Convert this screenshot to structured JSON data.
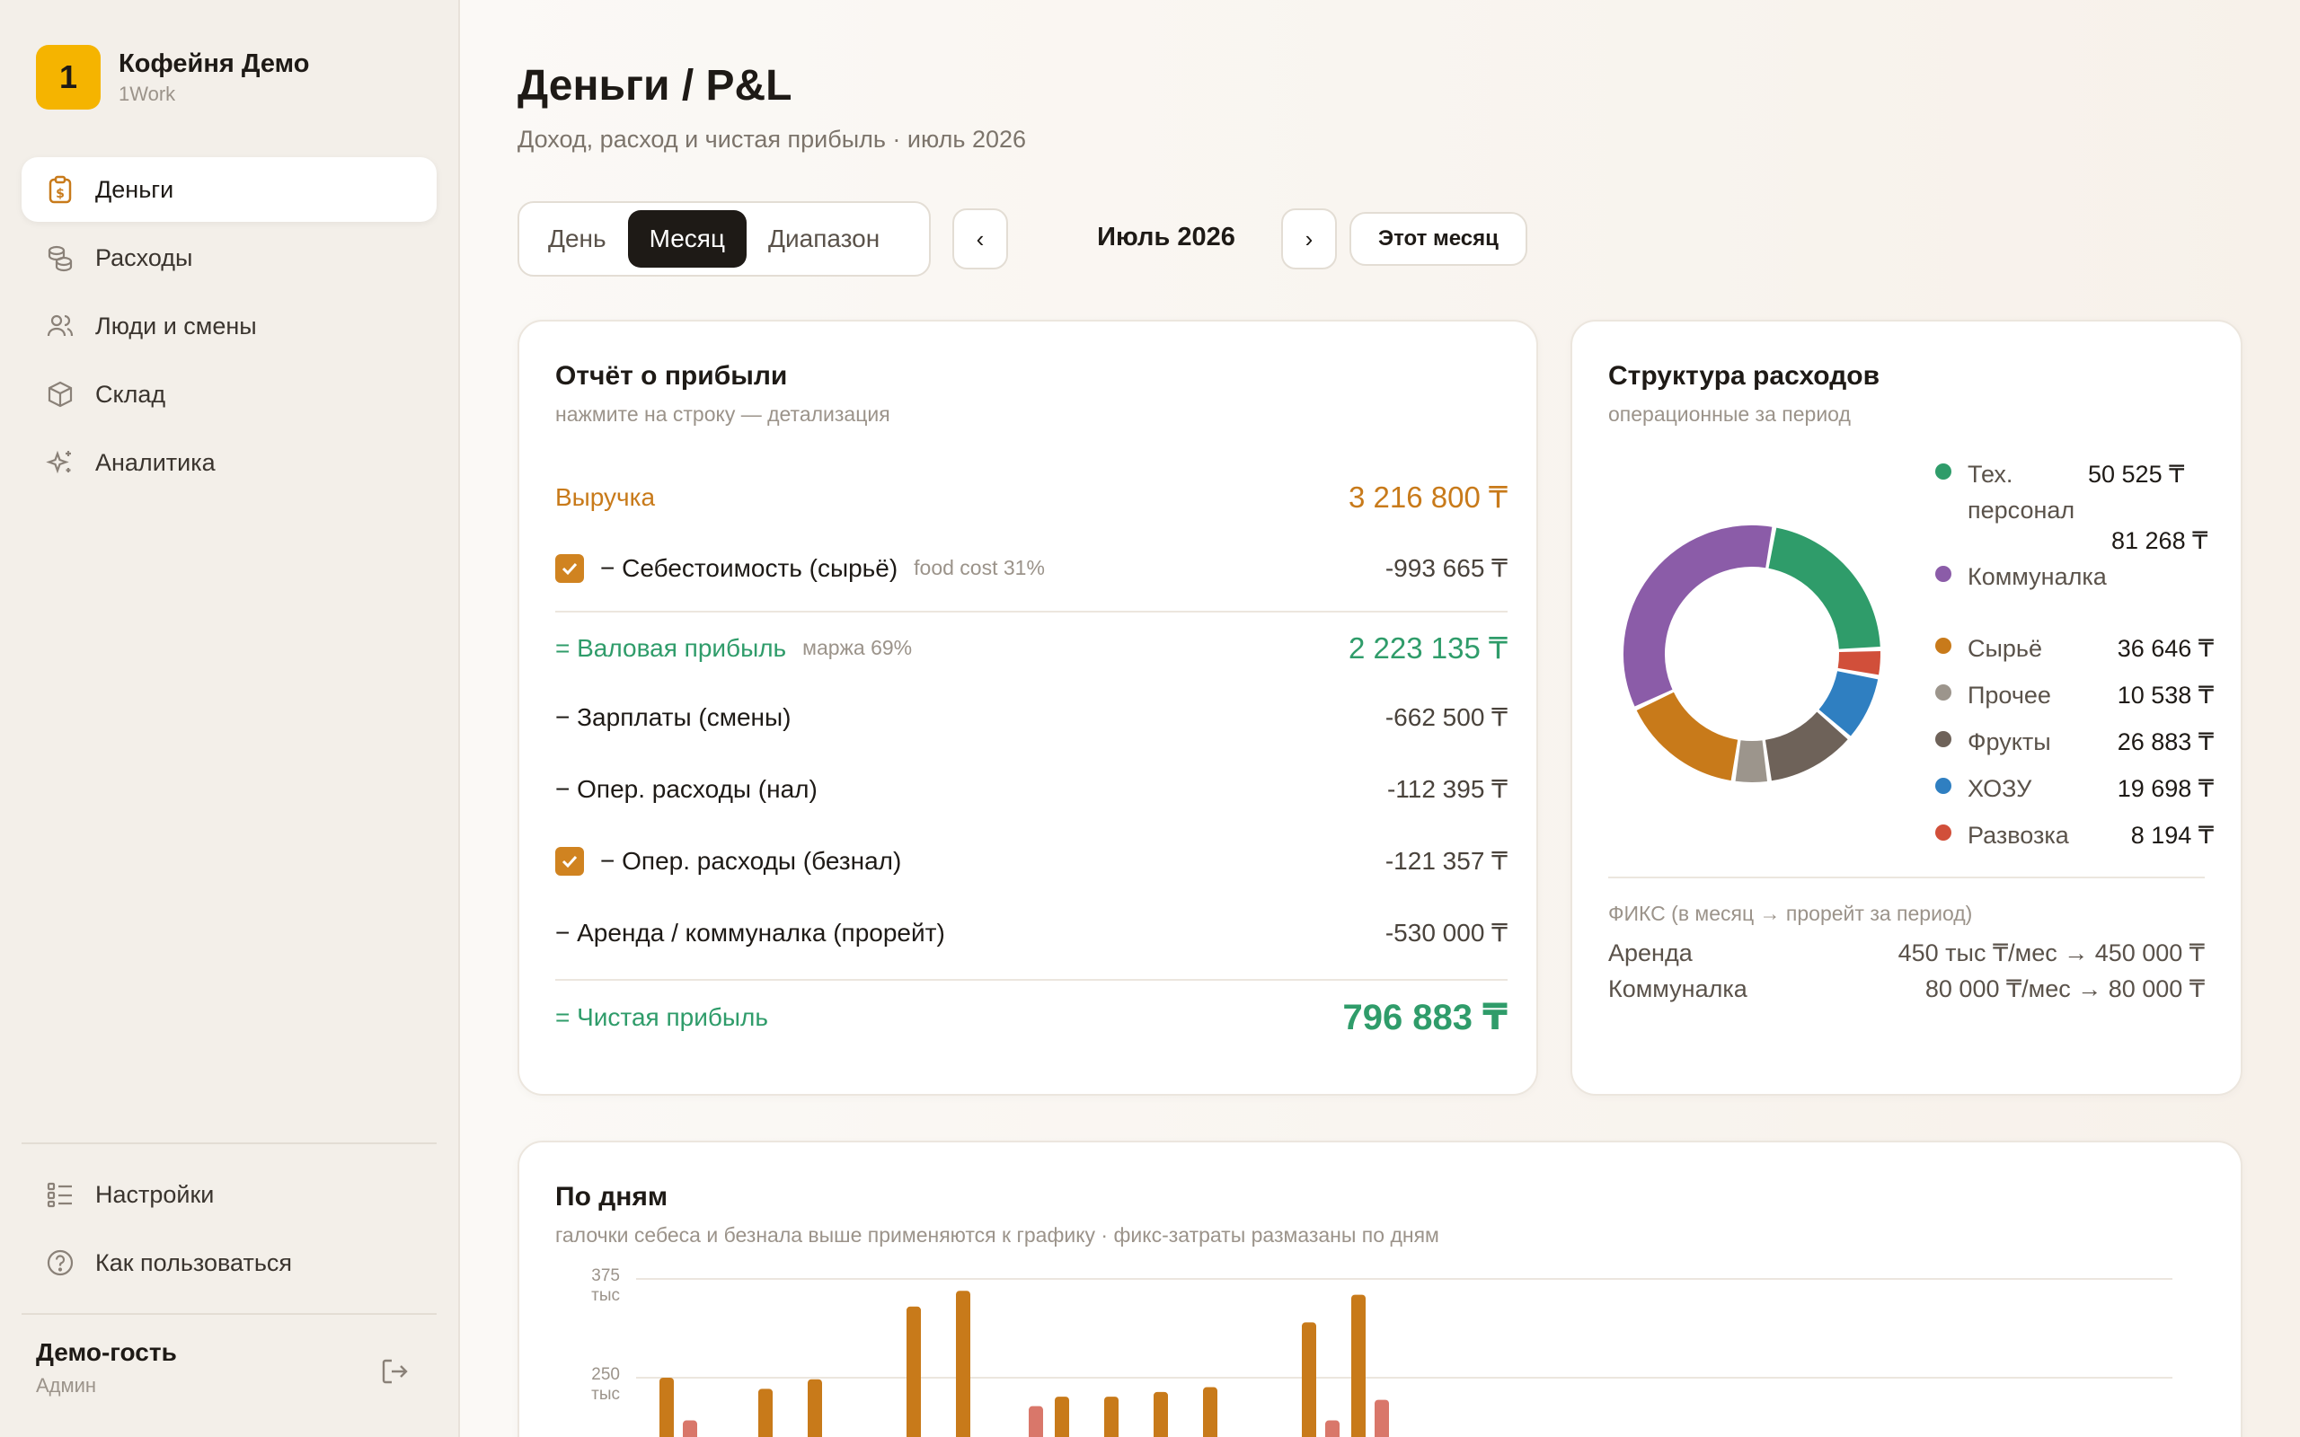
{
  "brand": {
    "logo": "1",
    "name": "Кофейня Демо",
    "sub": "1Work"
  },
  "nav": [
    {
      "label": "Деньги",
      "icon": "money-clipboard-icon",
      "active": true
    },
    {
      "label": "Расходы",
      "icon": "coins-icon"
    },
    {
      "label": "Люди и смены",
      "icon": "users-icon"
    },
    {
      "label": "Склад",
      "icon": "box-icon"
    },
    {
      "label": "Аналитика",
      "icon": "sparkle-icon"
    }
  ],
  "nav_bottom": [
    {
      "label": "Настройки",
      "icon": "settings-list-icon"
    },
    {
      "label": "Как пользоваться",
      "icon": "help-icon"
    }
  ],
  "user": {
    "name": "Демо-гость",
    "role": "Админ"
  },
  "header": {
    "title": "Деньги / P&L",
    "subtitle": "Доход, расход и чистая прибыль · июль 2026"
  },
  "toolbar": {
    "segments": [
      "День",
      "Месяц",
      "Диапазон"
    ],
    "active_segment": "Месяц",
    "prev": "‹",
    "next": "›",
    "period": "Июль 2026",
    "this_month": "Этот месяц"
  },
  "pl": {
    "title": "Отчёт о прибыли",
    "subtitle": "нажмите на строку — детализация",
    "revenue": {
      "label": "Выручка",
      "value": "3 216 800 ₸"
    },
    "cogs": {
      "label": "− Себестоимость (сырьё)",
      "note": "food cost 31%",
      "value": "-993 665 ₸",
      "checked": true
    },
    "gross": {
      "label": "= Валовая прибыль",
      "note": "маржа 69%",
      "value": "2 223 135 ₸"
    },
    "salaries": {
      "label": "− Зарплаты (смены)",
      "value": "-662 500 ₸"
    },
    "opex_cash": {
      "label": "− Опер. расходы (нал)",
      "value": "-112 395 ₸"
    },
    "opex_card": {
      "label": "− Опер. расходы (безнал)",
      "value": "-121 357 ₸",
      "checked": true
    },
    "rent": {
      "label": "− Аренда / коммуналка (прорейт)",
      "value": "-530 000 ₸"
    },
    "net": {
      "label": "= Чистая прибыль",
      "value": "796 883 ₸"
    }
  },
  "structure": {
    "title": "Структура расходов",
    "subtitle": "операционные за период",
    "legend": [
      {
        "name": "Тех. персонал",
        "value": "50 525 ₸",
        "color": "#2f9c6a"
      },
      {
        "name": "Коммуналка",
        "value": "81 268 ₸",
        "color": "#8b5ca8"
      },
      {
        "name": "Сырьё",
        "value": "36 646 ₸",
        "color": "#c87a1a"
      },
      {
        "name": "Прочее",
        "value": "10 538 ₸",
        "color": "#9c958c"
      },
      {
        "name": "Фрукты",
        "value": "26 883 ₸",
        "color": "#6e6259"
      },
      {
        "name": "ХОЗУ",
        "value": "19 698 ₸",
        "color": "#2f7fc1"
      },
      {
        "name": "Развозка",
        "value": "8 194 ₸",
        "color": "#d14f3a"
      }
    ],
    "fix_title": "ФИКС (в месяц → прорейт за период)",
    "fix": [
      {
        "name": "Аренда",
        "value": "450 тыс ₸/мес → 450 000 ₸"
      },
      {
        "name": "Коммуналка",
        "value": "80 000 ₸/мес → 80 000 ₸"
      }
    ]
  },
  "days": {
    "title": "По дням",
    "subtitle": "галочки себеса и безнала выше применяются к графику · фикс-затраты размазаны по дням"
  },
  "chart_data": {
    "type": "bar",
    "y_ticks": [
      {
        "value": 375,
        "label": "375",
        "unit": "тыс"
      },
      {
        "value": 250,
        "label": "250",
        "unit": "тыс"
      }
    ],
    "series": [
      {
        "color": "#c87a1a",
        "values": [
          250,
          0,
          236,
          248,
          0,
          340,
          360,
          0,
          226,
          226,
          232,
          238,
          0,
          320,
          355
        ]
      },
      {
        "color": "#d9776a",
        "values": [
          196,
          0,
          0,
          0,
          0,
          0,
          0,
          214,
          0,
          0,
          0,
          0,
          0,
          196,
          222
        ]
      }
    ]
  }
}
